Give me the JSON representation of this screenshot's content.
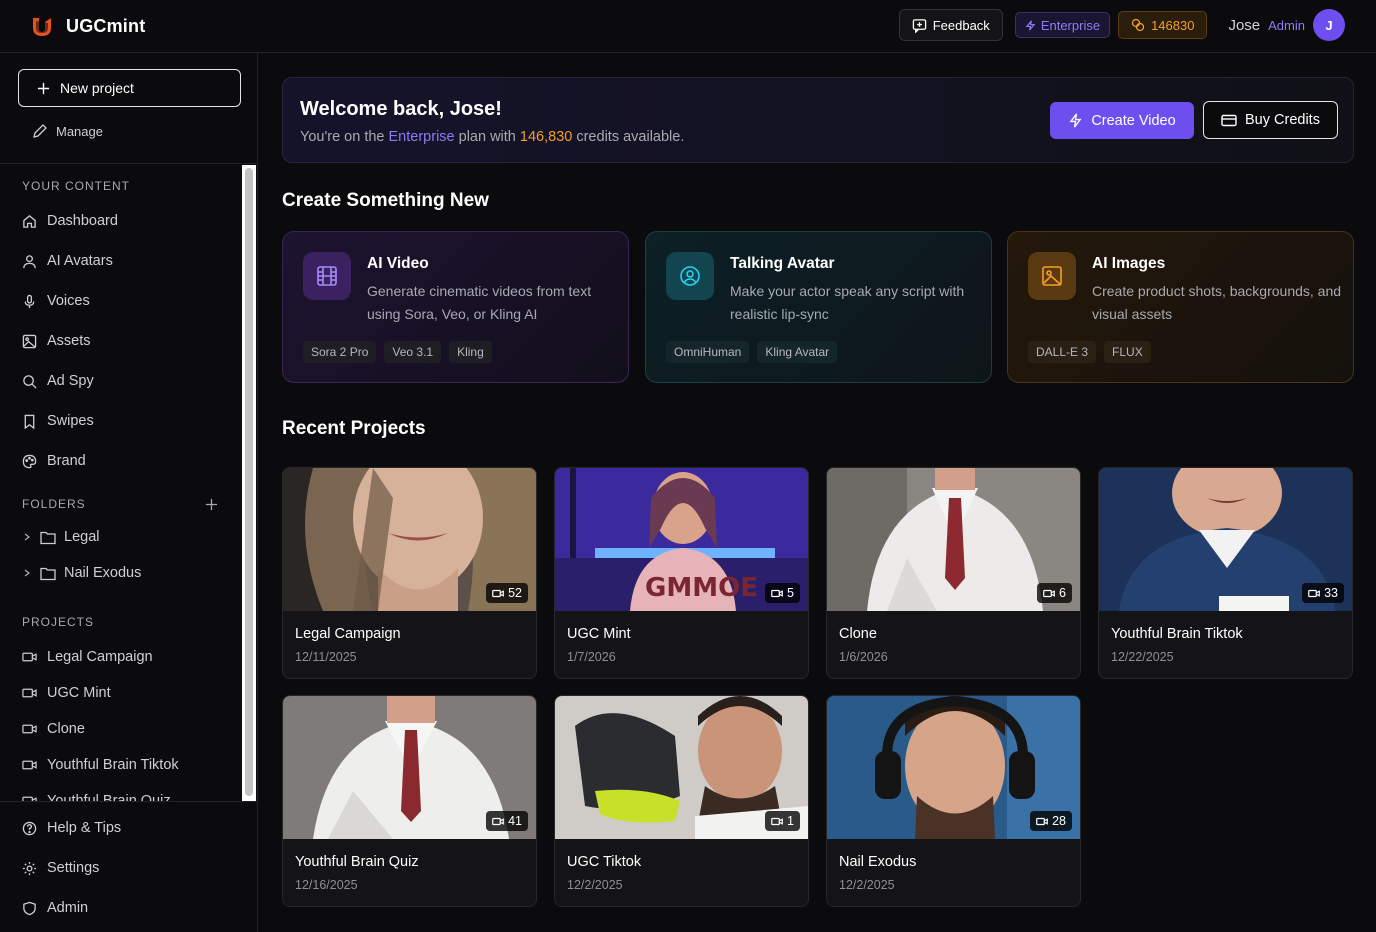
{
  "app": {
    "name": "UGCmint"
  },
  "header": {
    "feedback_label": "Feedback",
    "plan_label": "Enterprise",
    "credits_value": "146830",
    "user_name": "Jose",
    "user_role": "Admin",
    "avatar_initial": "J"
  },
  "sidebar": {
    "new_project_label": "New project",
    "manage_label": "Manage",
    "your_content_label": "YOUR CONTENT",
    "content_items": [
      {
        "label": "Dashboard",
        "icon": "home-icon"
      },
      {
        "label": "AI Avatars",
        "icon": "user-icon"
      },
      {
        "label": "Voices",
        "icon": "microphone-icon"
      },
      {
        "label": "Assets",
        "icon": "image-icon"
      },
      {
        "label": "Ad Spy",
        "icon": "search-icon"
      },
      {
        "label": "Swipes",
        "icon": "bookmark-icon"
      },
      {
        "label": "Brand",
        "icon": "palette-icon"
      }
    ],
    "folders_label": "FOLDERS",
    "folders": [
      {
        "label": "Legal"
      },
      {
        "label": "Nail Exodus"
      }
    ],
    "projects_label": "PROJECTS",
    "projects": [
      {
        "label": "Legal Campaign"
      },
      {
        "label": "UGC Mint"
      },
      {
        "label": "Clone"
      },
      {
        "label": "Youthful Brain Tiktok"
      },
      {
        "label": "Youthful Brain Quiz"
      }
    ],
    "bottom_items": [
      {
        "label": "Help & Tips",
        "icon": "help-icon"
      },
      {
        "label": "Settings",
        "icon": "gear-icon"
      },
      {
        "label": "Admin",
        "icon": "shield-icon"
      }
    ]
  },
  "welcome": {
    "title": "Welcome back, Jose!",
    "sub_prefix": "You're on the ",
    "plan": "Enterprise",
    "sub_mid": " plan with ",
    "credits": "146,830",
    "sub_suffix": " credits available.",
    "create_video_label": "Create Video",
    "buy_credits_label": "Buy Credits"
  },
  "create_section": {
    "heading": "Create Something New",
    "cards": [
      {
        "title": "AI Video",
        "desc": "Generate cinematic videos from text using Sora, Veo, or Kling AI",
        "tags": [
          "Sora 2 Pro",
          "Veo 3.1",
          "Kling"
        ],
        "icon": "film-icon",
        "accent": "#a78bfa"
      },
      {
        "title": "Talking Avatar",
        "desc": "Make your actor speak any script with realistic lip-sync",
        "tags": [
          "OmniHuman",
          "Kling Avatar"
        ],
        "icon": "user-circle-icon",
        "accent": "#22d3ee"
      },
      {
        "title": "AI Images",
        "desc": "Create product shots, backgrounds, and visual assets",
        "tags": [
          "DALL-E 3",
          "FLUX"
        ],
        "icon": "image-icon",
        "accent": "#f59e2a"
      }
    ]
  },
  "recent": {
    "heading": "Recent Projects",
    "projects": [
      {
        "title": "Legal Campaign",
        "date": "12/11/2025",
        "count": "52"
      },
      {
        "title": "UGC Mint",
        "date": "1/7/2026",
        "count": "5"
      },
      {
        "title": "Clone",
        "date": "1/6/2026",
        "count": "6"
      },
      {
        "title": "Youthful Brain Tiktok",
        "date": "12/22/2025",
        "count": "33"
      },
      {
        "title": "Youthful Brain Quiz",
        "date": "12/16/2025",
        "count": "41"
      },
      {
        "title": "UGC Tiktok",
        "date": "12/2/2025",
        "count": "1"
      },
      {
        "title": "Nail Exodus",
        "date": "12/2/2025",
        "count": "28"
      }
    ]
  }
}
